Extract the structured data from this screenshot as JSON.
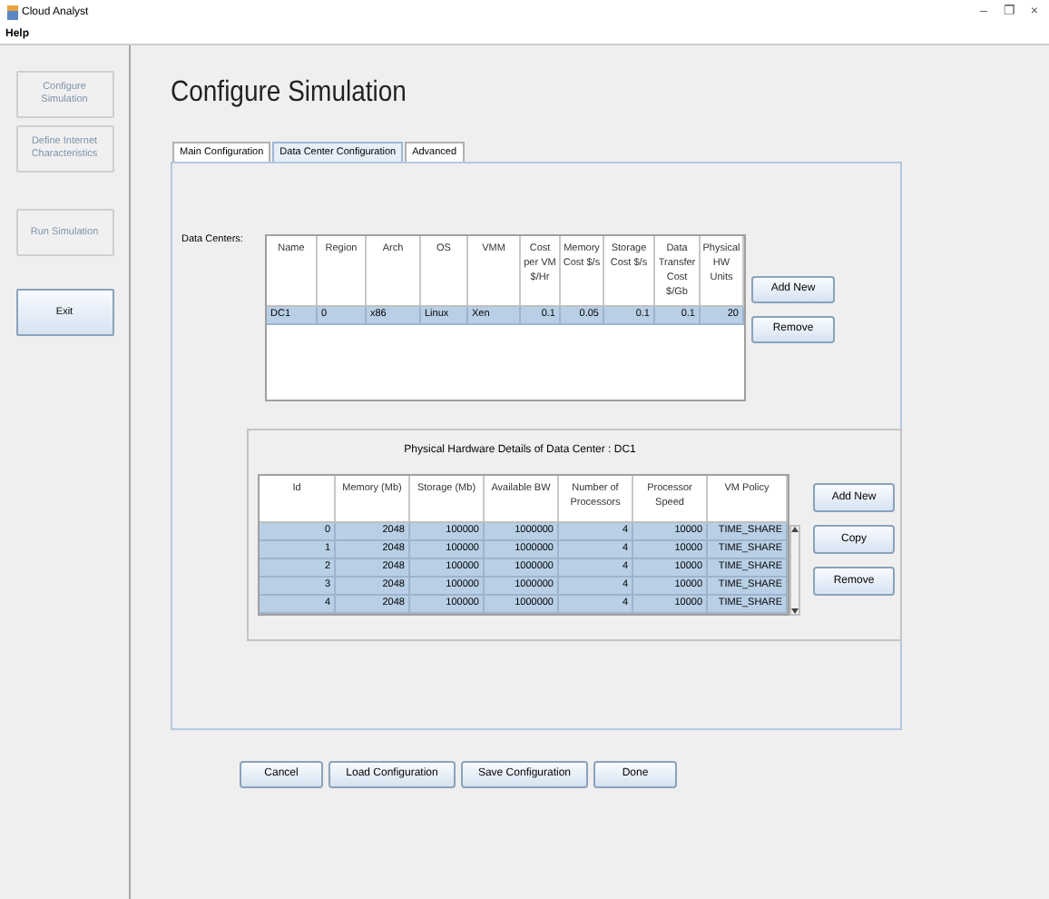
{
  "window": {
    "title": "Cloud Analyst",
    "controls": [
      "–",
      "❐",
      "×"
    ]
  },
  "menu": [
    "Help"
  ],
  "sidebar": [
    {
      "label": "Configure Simulation",
      "disabled": true
    },
    {
      "label": "Define Internet Characteristics",
      "disabled": true
    },
    {
      "label": "Run Simulation",
      "disabled": true
    },
    {
      "label": "Exit",
      "disabled": false
    }
  ],
  "heading": "Configure Simulation",
  "tabs": [
    {
      "label": "Main Configuration",
      "selected": false
    },
    {
      "label": "Data Center Configuration",
      "selected": true
    },
    {
      "label": "Advanced",
      "selected": false
    }
  ],
  "data_centers": {
    "label": "Data Centers:",
    "columns": [
      "Name",
      "Region",
      "Arch",
      "OS",
      "VMM",
      "Cost per VM $/Hr",
      "Memory Cost $/s",
      "Storage Cost $/s",
      "Data Transfer Cost $/Gb",
      "Physical HW Units"
    ],
    "rows": [
      {
        "cells": [
          "DC1",
          "0",
          "x86",
          "Linux",
          "Xen",
          "0.1",
          "0.05",
          "0.1",
          "0.1",
          "20"
        ],
        "selected": true
      }
    ],
    "buttons": [
      "Add New",
      "Remove"
    ]
  },
  "hardware": {
    "title": "Physical Hardware Details of Data Center : DC1",
    "columns": [
      "Id",
      "Memory (Mb)",
      "Storage (Mb)",
      "Available BW",
      "Number of Processors",
      "Processor Speed",
      "VM Policy"
    ],
    "rows": [
      {
        "cells": [
          "0",
          "2048",
          "100000",
          "1000000",
          "4",
          "10000",
          "TIME_SHARE"
        ],
        "selected": true
      },
      {
        "cells": [
          "1",
          "2048",
          "100000",
          "1000000",
          "4",
          "10000",
          "TIME_SHARE"
        ],
        "selected": true
      },
      {
        "cells": [
          "2",
          "2048",
          "100000",
          "1000000",
          "4",
          "10000",
          "TIME_SHARE"
        ],
        "selected": true
      },
      {
        "cells": [
          "3",
          "2048",
          "100000",
          "1000000",
          "4",
          "10000",
          "TIME_SHARE"
        ],
        "selected": true
      },
      {
        "cells": [
          "4",
          "2048",
          "100000",
          "1000000",
          "4",
          "10000",
          "TIME_SHARE"
        ],
        "selected": true
      }
    ],
    "buttons": [
      "Add New",
      "Copy",
      "Remove"
    ]
  },
  "footer_buttons": [
    "Cancel",
    "Load Configuration",
    "Save Configuration",
    "Done"
  ]
}
